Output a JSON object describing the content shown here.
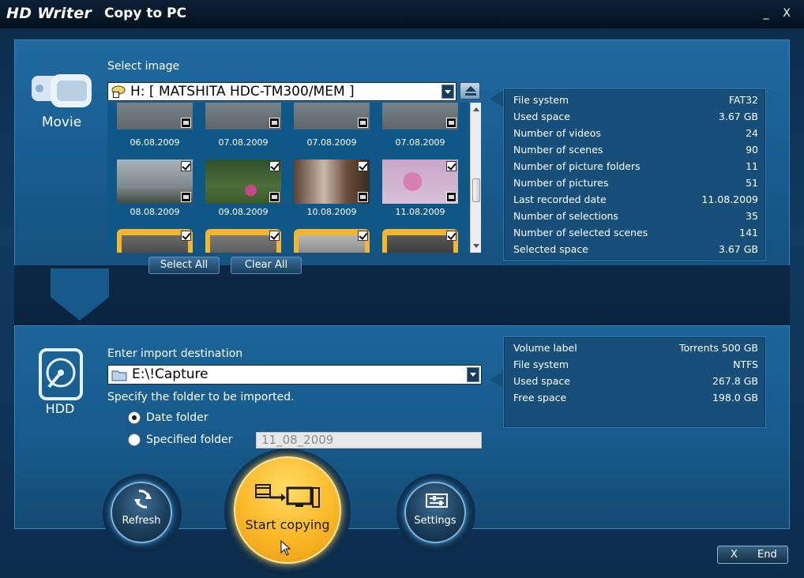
{
  "titlebar": {
    "app_title": "HD Writer",
    "screen_title": "Copy to PC",
    "minimize_label": "_",
    "close_label": "X"
  },
  "source": {
    "mode_label": "Movie",
    "select_image_label": "Select image",
    "drive_value": "H: [ MATSHITA HDC-TM300/MEM ]",
    "thumbnails": [
      {
        "date": "06.08.2009",
        "checked": true
      },
      {
        "date": "07.08.2009",
        "checked": true
      },
      {
        "date": "07.08.2009",
        "checked": true
      },
      {
        "date": "07.08.2009",
        "checked": true
      },
      {
        "date": "08.08.2009",
        "checked": true
      },
      {
        "date": "09.08.2009",
        "checked": true
      },
      {
        "date": "10.08.2009",
        "checked": true
      },
      {
        "date": "11.08.2009",
        "checked": true
      },
      {
        "date": "",
        "checked": true
      },
      {
        "date": "",
        "checked": true
      },
      {
        "date": "",
        "checked": true
      },
      {
        "date": "",
        "checked": true
      }
    ],
    "select_all_label": "Select All",
    "clear_all_label": "Clear All",
    "info": [
      {
        "key": "File system",
        "value": "FAT32"
      },
      {
        "key": "Used space",
        "value": "3.67 GB"
      },
      {
        "key": "Number of videos",
        "value": "24"
      },
      {
        "key": "Number of scenes",
        "value": "90"
      },
      {
        "key": "Number of picture folders",
        "value": "11"
      },
      {
        "key": "Number of pictures",
        "value": "51"
      },
      {
        "key": "Last recorded date",
        "value": "11.08.2009"
      },
      {
        "key": "Number of selections",
        "value": "35"
      },
      {
        "key": "Number of selected scenes",
        "value": "141"
      },
      {
        "key": "Selected space",
        "value": "3.67 GB"
      }
    ]
  },
  "destination": {
    "mode_label": "HDD",
    "enter_label": "Enter import destination",
    "path_value": "E:\\!Capture",
    "specify_label": "Specify the folder to be imported.",
    "radio_date_label": "Date folder",
    "radio_specified_label": "Specified folder",
    "folder_name_value": "11_08_2009",
    "info": [
      {
        "key": "Volume label",
        "value": "Torrents 500 GB"
      },
      {
        "key": "File system",
        "value": "NTFS"
      },
      {
        "key": "Used space",
        "value": "267.8 GB"
      },
      {
        "key": "Free space",
        "value": "198.0 GB"
      }
    ]
  },
  "actions": {
    "refresh_label": "Refresh",
    "start_label": "Start copying",
    "settings_label": "Settings",
    "end_x": "X",
    "end_label": "End"
  },
  "colors": {
    "accent": "#fbb827",
    "panel": "#17598a",
    "background": "#0d2b4a"
  }
}
